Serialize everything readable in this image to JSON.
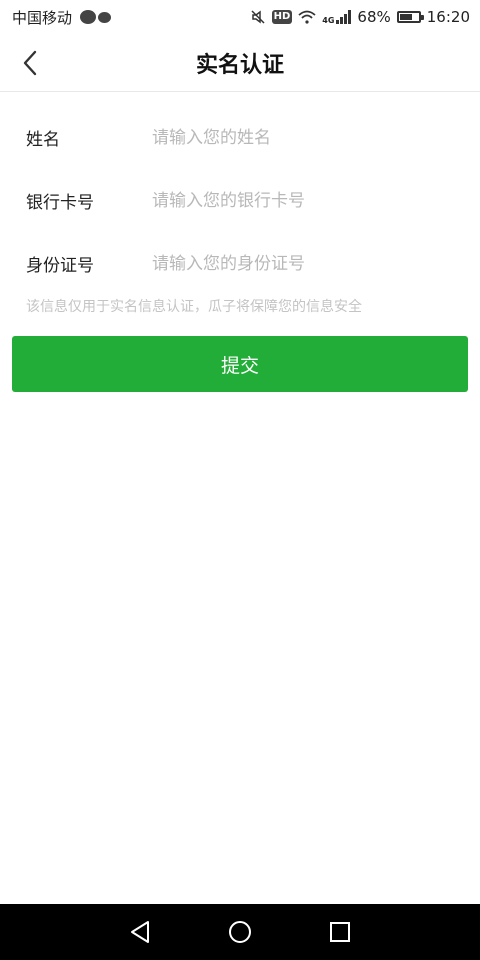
{
  "status_bar": {
    "carrier": "中国移动",
    "network_label": "4G",
    "hd_label": "HD",
    "battery": "68%",
    "battery_level": 0.68,
    "time": "16:20"
  },
  "header": {
    "title": "实名认证"
  },
  "form": {
    "fields": [
      {
        "label": "姓名",
        "placeholder": "请输入您的姓名",
        "value": ""
      },
      {
        "label": "银行卡号",
        "placeholder": "请输入您的银行卡号",
        "value": ""
      },
      {
        "label": "身份证号",
        "placeholder": "请输入您的身份证号",
        "value": ""
      }
    ],
    "note": "该信息仅用于实名信息认证，瓜子将保障您的信息安全",
    "submit_label": "提交"
  },
  "colors": {
    "accent": "#22ad38",
    "nav_background": "#000000",
    "placeholder": "#b8b8b8",
    "note": "#c4c4c4"
  },
  "icons": {
    "back": "chevron-left-icon",
    "nav_back": "triangle-back-icon",
    "nav_home": "circle-home-icon",
    "nav_recents": "square-recents-icon"
  }
}
